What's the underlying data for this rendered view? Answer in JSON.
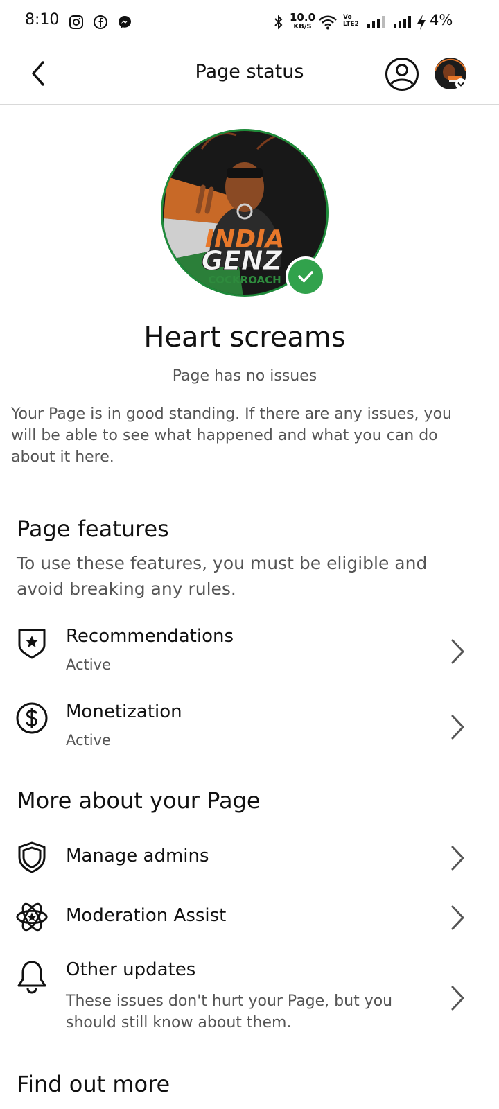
{
  "status_bar": {
    "time": "8:10",
    "net_speed_value": "10.0",
    "net_speed_unit": "KB/S",
    "volte_line1": "Vo",
    "volte_line2": "LTE2",
    "battery": "4%",
    "notification_icons": [
      "instagram-icon",
      "facebook-icon",
      "messenger-icon"
    ],
    "system_icons": [
      "bluetooth-icon",
      "wifi-icon",
      "signal-icon",
      "signal-icon",
      "charging-icon"
    ]
  },
  "header": {
    "title": "Page status"
  },
  "profile": {
    "logo_line1": "INDIA",
    "logo_line2": "GENZ",
    "logo_line3": "COCKROACH",
    "name": "Heart screams",
    "status": "Page has no issues",
    "description": "Your Page is in good standing. If there are any issues, you will be able to see what happened and what you can do about it here."
  },
  "features": {
    "title": "Page features",
    "subtitle": "To use these features, you must be eligible and avoid breaking any rules.",
    "items": [
      {
        "label": "Recommendations",
        "status": "Active",
        "icon": "shield-star-icon"
      },
      {
        "label": "Monetization",
        "status": "Active",
        "icon": "dollar-icon"
      }
    ]
  },
  "more": {
    "title": "More about your Page",
    "items": [
      {
        "label": "Manage admins",
        "icon": "shield-icon"
      },
      {
        "label": "Moderation Assist",
        "icon": "atom-star-icon"
      },
      {
        "label": "Other updates",
        "description": "These issues don't hurt your Page, but you should still know about them.",
        "icon": "bell-icon"
      }
    ]
  },
  "next_section_title": "Find out more",
  "colors": {
    "verified": "#31a24c",
    "text_primary": "#111111",
    "text_secondary": "#555555",
    "logo_orange": "#e8782a",
    "logo_green": "#2e8b3d"
  }
}
